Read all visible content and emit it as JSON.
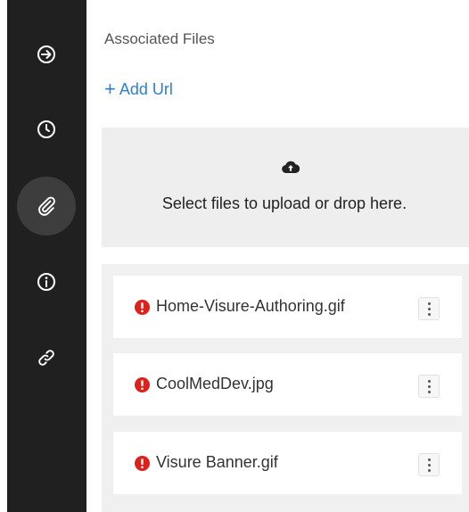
{
  "sidebar": {
    "items": [
      {
        "icon": "arrow-right-circle-icon",
        "active": false
      },
      {
        "icon": "clock-icon",
        "active": false
      },
      {
        "icon": "paperclip-icon",
        "active": true
      },
      {
        "icon": "info-icon",
        "active": false
      },
      {
        "icon": "link-icon",
        "active": false
      }
    ]
  },
  "main": {
    "title": "Associated Files",
    "add_url": {
      "icon": "plus-icon",
      "label": "Add Url"
    },
    "dropzone": {
      "icon": "cloud-upload-icon",
      "text": "Select files to upload or drop here."
    },
    "files": [
      {
        "name": "Home-Visure-Authoring.gif",
        "status_icon": "error-icon",
        "status_color": "#e0201b"
      },
      {
        "name": "CoolMedDev.jpg",
        "status_icon": "error-icon",
        "status_color": "#e0201b"
      },
      {
        "name": "Visure Banner.gif",
        "status_icon": "error-icon",
        "status_color": "#e0201b"
      }
    ]
  },
  "colors": {
    "sidebar_bg": "#202020",
    "sidebar_active": "#3d3d3d",
    "accent": "#2b7fd6",
    "error": "#e0201b"
  }
}
